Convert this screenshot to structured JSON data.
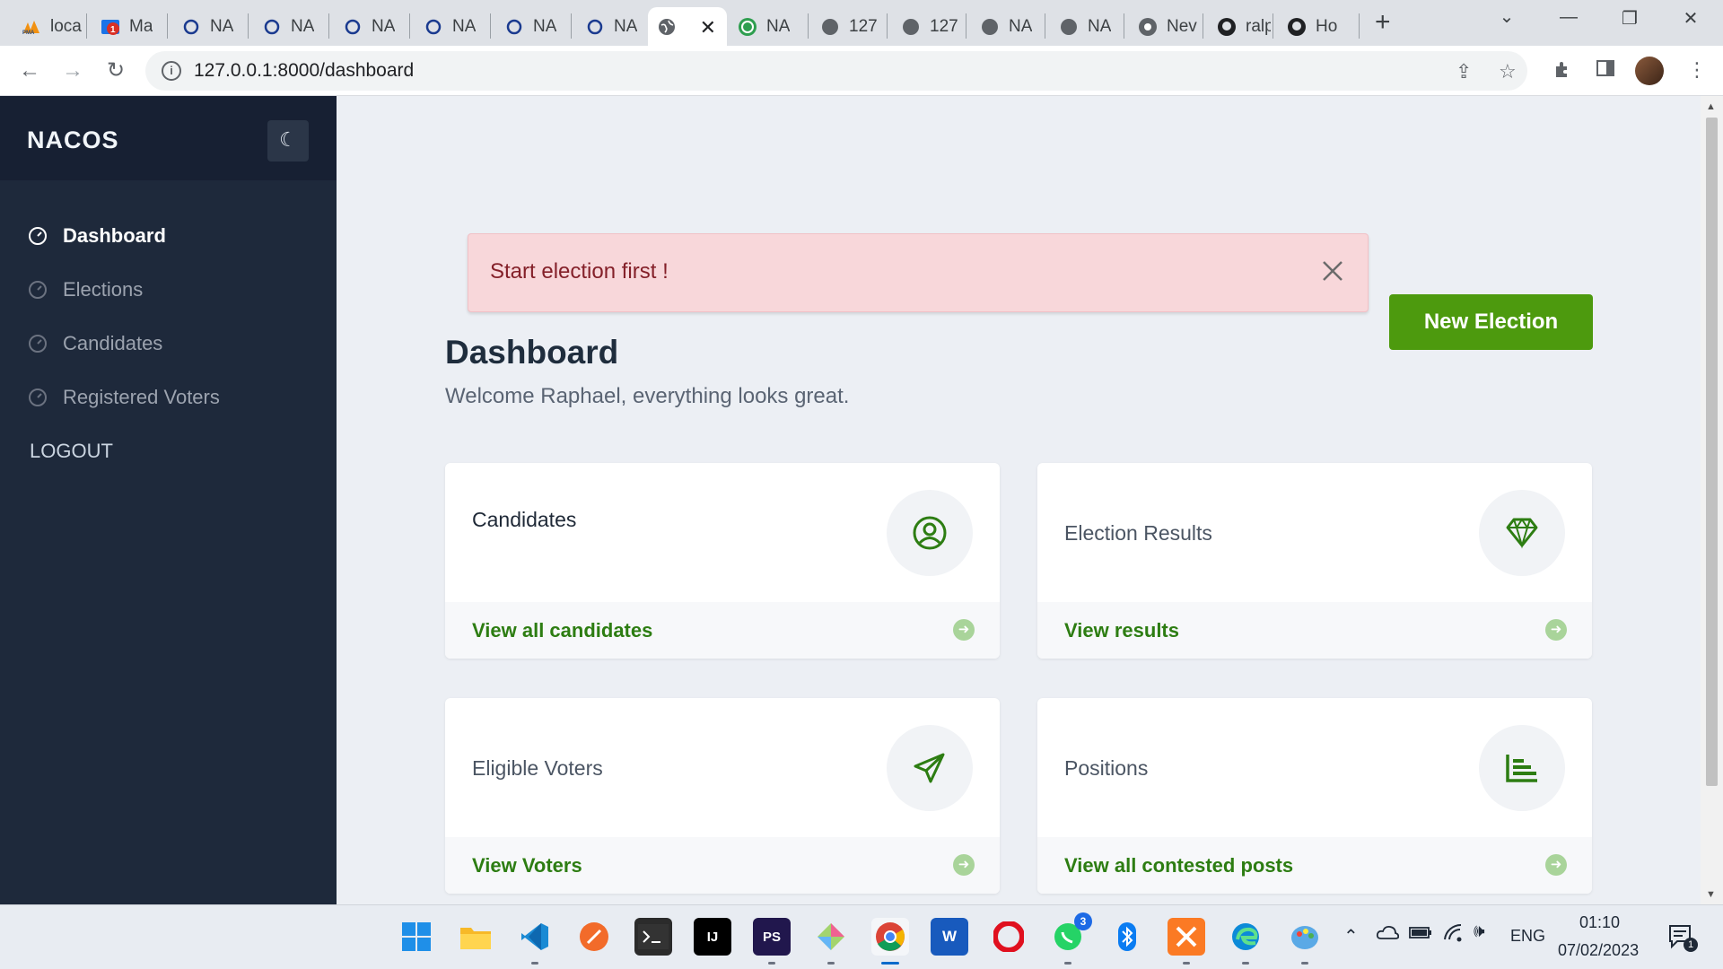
{
  "browser": {
    "tabs": [
      {
        "title": "loca",
        "icon": "phpmyadmin-icon"
      },
      {
        "title": "Ma",
        "icon": "mail-icon"
      },
      {
        "title": "NA",
        "icon": "loading-icon"
      },
      {
        "title": "NA",
        "icon": "loading-icon"
      },
      {
        "title": "NA",
        "icon": "loading-icon"
      },
      {
        "title": "NA",
        "icon": "loading-icon"
      },
      {
        "title": "NA",
        "icon": "loading-icon"
      },
      {
        "title": "NA",
        "icon": "loading-icon"
      },
      {
        "title": "",
        "icon": "globe-icon",
        "active": true
      },
      {
        "title": "NA",
        "icon": "shield-icon"
      },
      {
        "title": "127",
        "icon": "globe-icon"
      },
      {
        "title": "127",
        "icon": "globe-icon"
      },
      {
        "title": "NA",
        "icon": "globe-icon"
      },
      {
        "title": "NA",
        "icon": "globe-icon"
      },
      {
        "title": "Nev",
        "icon": "chrome-icon"
      },
      {
        "title": "ralp",
        "icon": "github-icon"
      },
      {
        "title": "Ho",
        "icon": "github-icon"
      }
    ],
    "url": "127.0.0.1:8000/dashboard"
  },
  "sidebar": {
    "brand": "NACOS",
    "items": [
      {
        "label": "Dashboard",
        "active": true
      },
      {
        "label": "Elections",
        "active": false
      },
      {
        "label": "Candidates",
        "active": false
      },
      {
        "label": "Registered Voters",
        "active": false
      }
    ],
    "logout": "LOGOUT"
  },
  "alert": {
    "message": "Start election first !"
  },
  "new_election_label": "New Election",
  "page": {
    "title": "Dashboard",
    "welcome": "Welcome Raphael, everything looks great."
  },
  "cards": [
    {
      "title": "Candidates",
      "link": "View all candidates",
      "icon": "user-circle-icon"
    },
    {
      "title": "Election Results",
      "link": "View results",
      "icon": "diamond-icon"
    },
    {
      "title": "Eligible Voters",
      "link": "View Voters",
      "icon": "paper-plane-icon"
    },
    {
      "title": "Positions",
      "link": "View all contested posts",
      "icon": "bar-chart-icon"
    }
  ],
  "taskbar": {
    "language": "ENG",
    "time": "01:10",
    "date": "07/02/2023",
    "whatsapp_badge": "3",
    "notification_badge": "1"
  },
  "colors": {
    "sidebar_bg": "#1e293b",
    "accent_green": "#4d9a0e",
    "link_green": "#2d7d12",
    "alert_bg": "#f8d7da",
    "alert_text": "#842029"
  }
}
